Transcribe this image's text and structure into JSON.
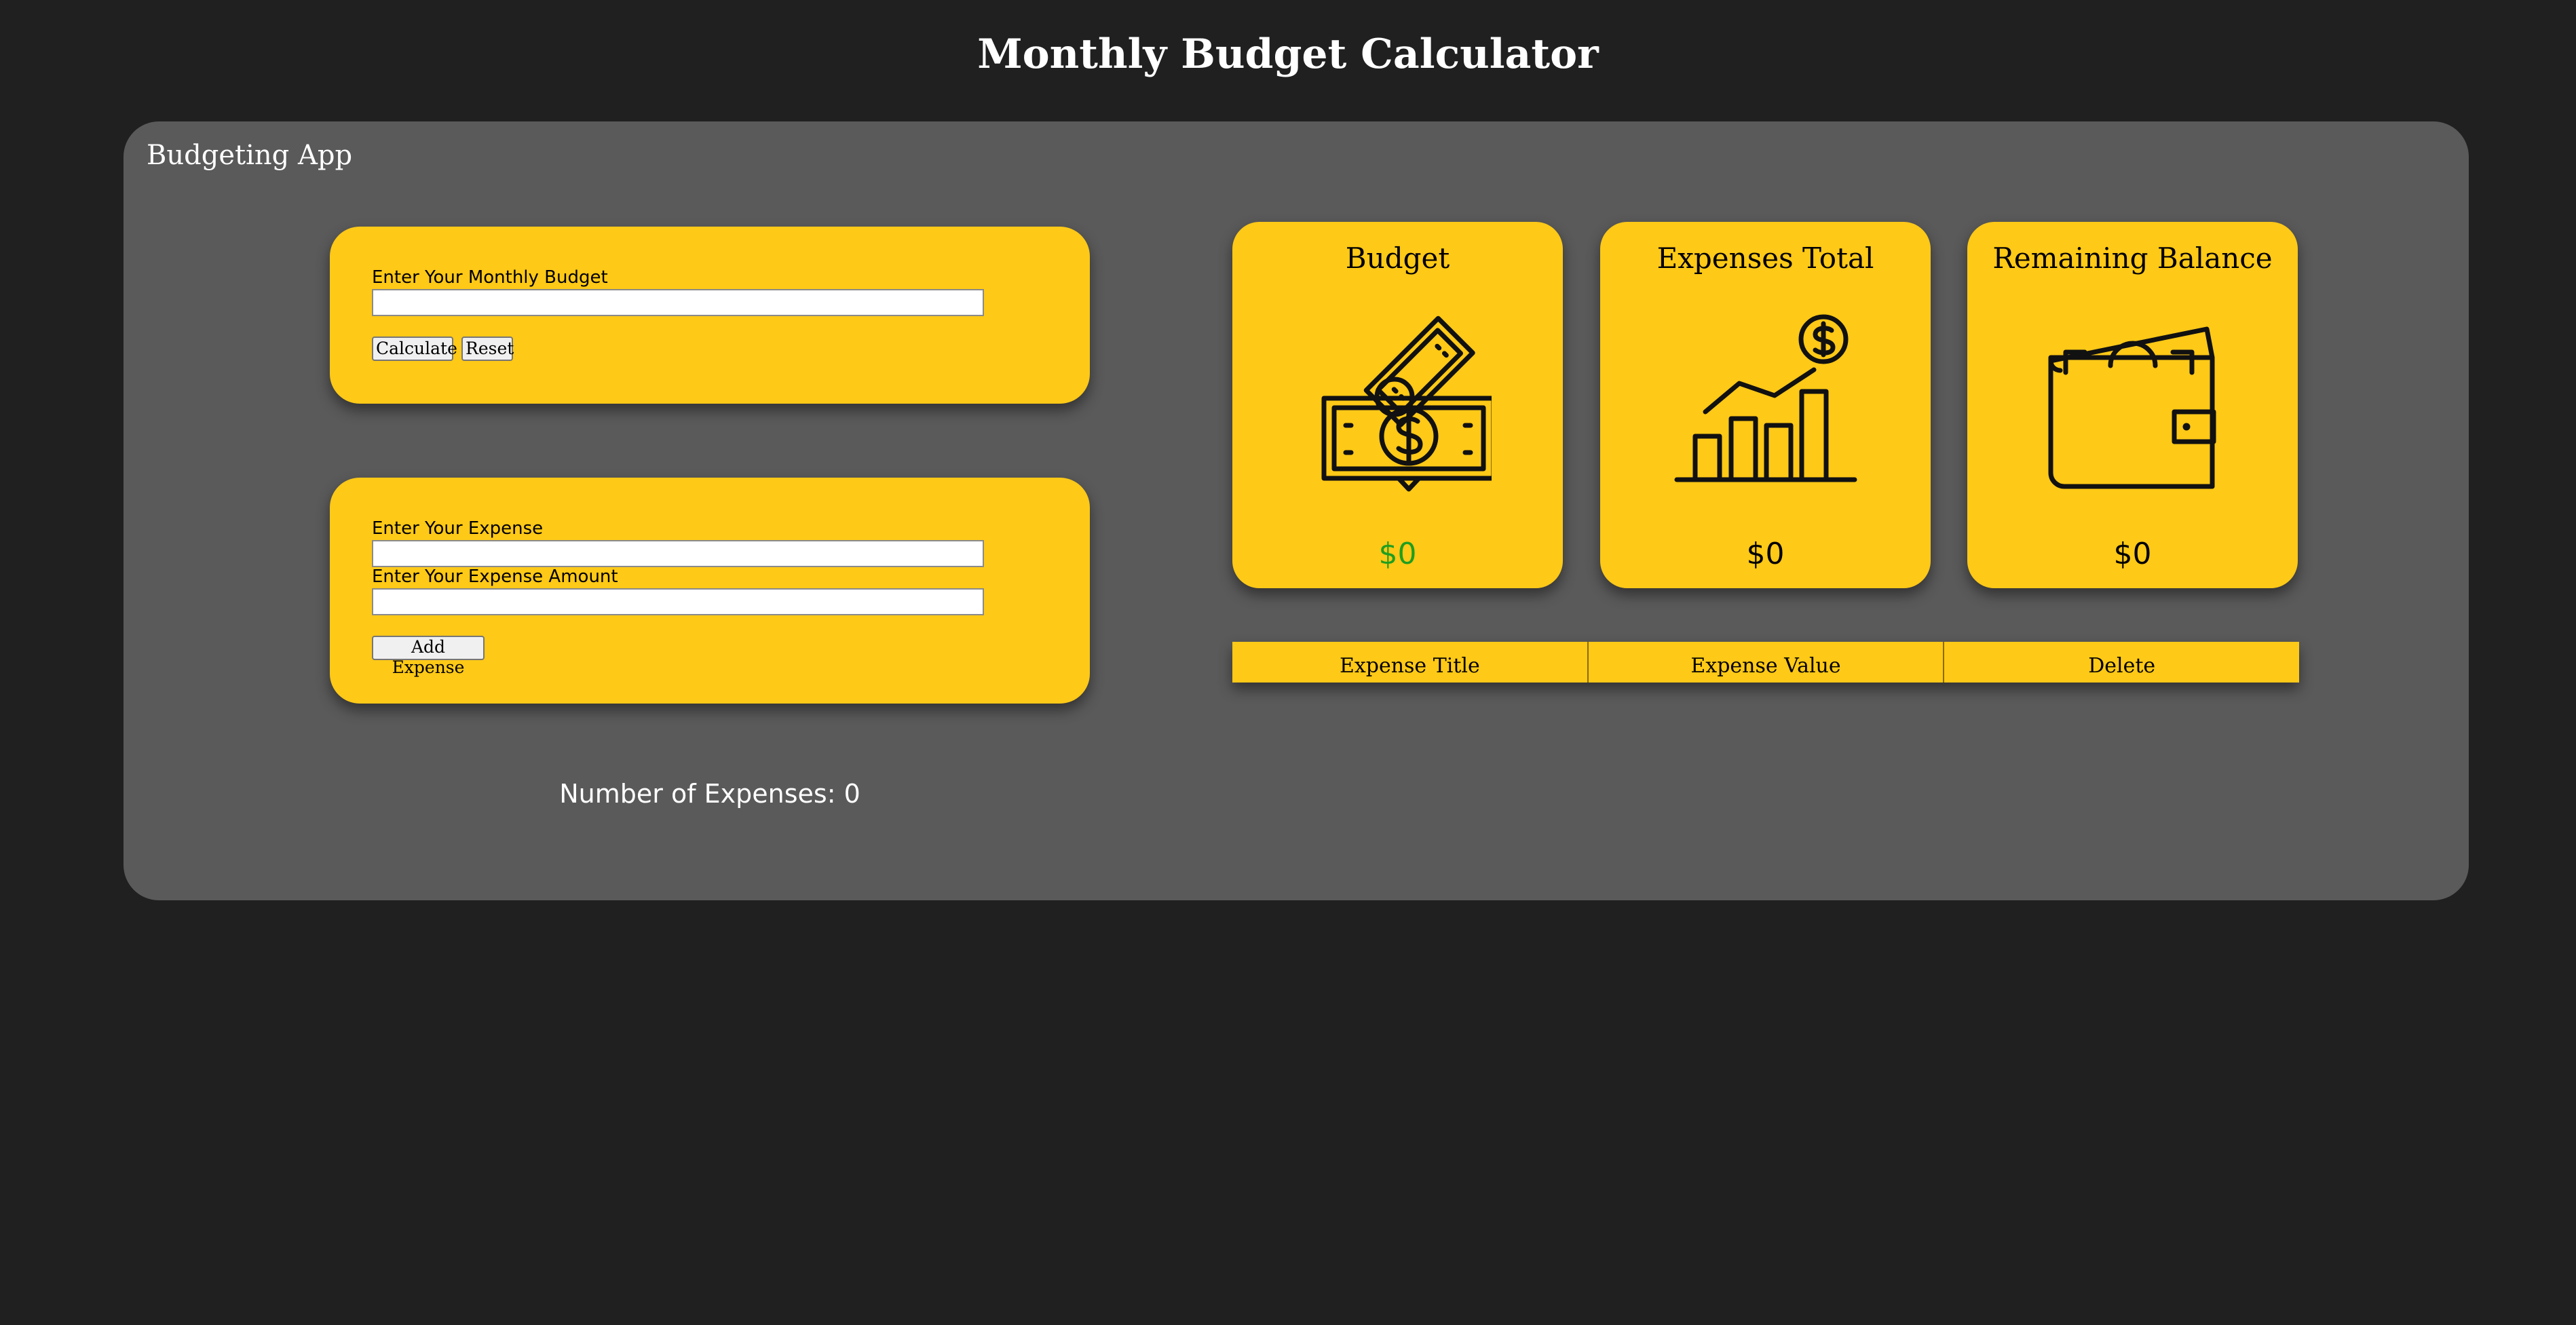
{
  "page": {
    "title": "Monthly Budget Calculator"
  },
  "app": {
    "title": "Budgeting App"
  },
  "budget_form": {
    "label": "Enter Your Monthly Budget",
    "input_value": "",
    "calculate_label": "Calculate",
    "reset_label": "Reset"
  },
  "expense_form": {
    "expense_label": "Enter Your Expense",
    "expense_value": "",
    "amount_label": "Enter Your Expense Amount",
    "amount_value": "",
    "add_label": "Add Expense"
  },
  "expense_count": "Number of Expenses: 0",
  "stats": [
    {
      "title": "Budget",
      "value": "$0",
      "icon": "money-icon",
      "value_color": "#1f9e1f"
    },
    {
      "title": "Expenses Total",
      "value": "$0",
      "icon": "chart-icon",
      "value_color": "#000000"
    },
    {
      "title": "Remaining Balance",
      "value": "$0",
      "icon": "wallet-icon",
      "value_color": "#000000"
    }
  ],
  "table": {
    "headers": [
      "Expense Title",
      "Expense Value",
      "Delete"
    ],
    "rows": []
  },
  "colors": {
    "background": "#202020",
    "panel": "#5a5a5a",
    "card": "#ffc917"
  }
}
